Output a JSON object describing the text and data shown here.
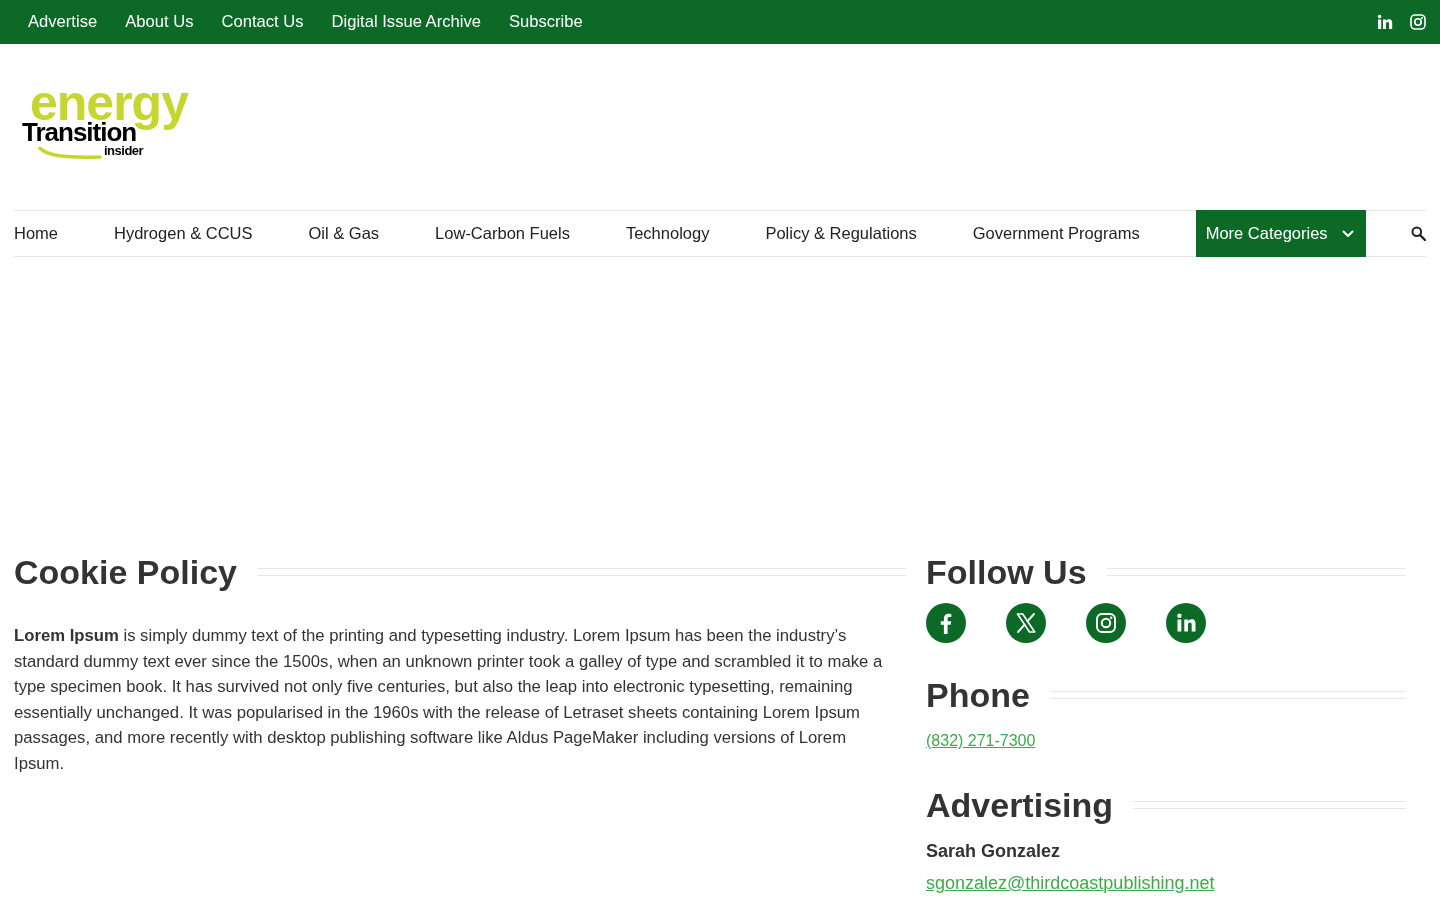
{
  "top_bar": {
    "links": [
      "Advertise",
      "About Us",
      "Contact Us",
      "Digital Issue Archive",
      "Subscribe"
    ]
  },
  "logo": {
    "word_1": "energy",
    "word_2": "Transition",
    "word_3": "insider"
  },
  "nav": {
    "items": [
      {
        "label": "Home",
        "kind": "link"
      },
      {
        "label": "Hydrogen & CCUS",
        "kind": "link"
      },
      {
        "label": "Oil & Gas",
        "kind": "link"
      },
      {
        "label": "Low-Carbon Fuels",
        "kind": "link"
      },
      {
        "label": "Technology",
        "kind": "link"
      },
      {
        "label": "Policy & Regulations",
        "kind": "link"
      },
      {
        "label": "Government Programs",
        "kind": "link"
      },
      {
        "label": "More Categories",
        "kind": "dropdown"
      }
    ]
  },
  "main": {
    "title": "Cookie Policy",
    "body": "**Lorem Ipsum** is simply dummy text of the printing and typesetting industry. Lorem Ipsum has been the industry’s standard dummy text ever since the 1500s, when an unknown printer took a galley of type and scrambled it to make a type specimen book. It has survived not only five centuries, but also the leap into electronic typesetting, remaining essentially unchanged. It was popularised in the 1960s with the release of Letraset sheets containing Lorem Ipsum passages, and more recently with desktop publishing software like Aldus PageMaker including versions of Lorem Ipsum."
  },
  "sidebar": {
    "sections": [
      {
        "kind": "social",
        "title": "Follow Us"
      },
      {
        "kind": "phone",
        "title": "Phone",
        "link": "(832) 271-7300"
      },
      {
        "kind": "contact",
        "title": "Advertising",
        "name": "Sarah Gonzalez",
        "link": "sgonzalez@thirdcoastpublishing.net"
      }
    ]
  }
}
